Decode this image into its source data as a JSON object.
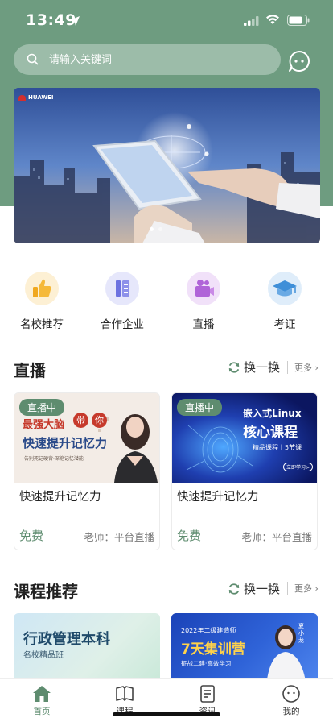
{
  "status_bar": {
    "time": "13:49"
  },
  "search": {
    "placeholder": "请输入关键词"
  },
  "banner": {
    "brand": "HUAWEI"
  },
  "categories": [
    {
      "label": "名校推荐",
      "icon": "thumbs-up-icon",
      "color": "#f5b93a"
    },
    {
      "label": "合作企业",
      "icon": "company-icon",
      "color": "#6d72e0"
    },
    {
      "label": "直播",
      "icon": "video-camera-icon",
      "color": "#b064d8"
    },
    {
      "label": "考证",
      "icon": "graduation-cap-icon",
      "color": "#3f8fd8"
    }
  ],
  "live_section": {
    "title": "直播",
    "refresh_label": "换一换",
    "more_label": "更多",
    "cards": [
      {
        "badge": "直播中",
        "image_lines": [
          "最强大脑",
          "带",
          "你",
          "快速提升记忆力",
          "告别死记硬背·深挖记忆潜能"
        ],
        "title": "快速提升记忆力",
        "price": "免费",
        "teacher": "老师：平台直播"
      },
      {
        "badge": "直播中",
        "image_lines": [
          "嵌入式Linux",
          "核心课程",
          "精品课程丨5节课",
          "立即学习>"
        ],
        "title": "快速提升记忆力",
        "price": "免费",
        "teacher": "老师：平台直播"
      }
    ]
  },
  "course_section": {
    "title": "课程推荐",
    "refresh_label": "换一换",
    "more_label": "更多",
    "cards": [
      {
        "image_lines": [
          "行政管理本科",
          "名校精品班"
        ]
      },
      {
        "image_lines": [
          "2022年二级建造师",
          "7天集训营",
          "征战二建·高效学习",
          "夏小龙"
        ]
      }
    ]
  },
  "tabbar": [
    {
      "label": "首页",
      "icon": "home-icon",
      "active": true
    },
    {
      "label": "课程",
      "icon": "book-icon",
      "active": false
    },
    {
      "label": "资讯",
      "icon": "news-icon",
      "active": false
    },
    {
      "label": "我的",
      "icon": "profile-icon",
      "active": false
    }
  ],
  "colors": {
    "header": "#6e9c80",
    "accent": "#5e8c6f"
  }
}
